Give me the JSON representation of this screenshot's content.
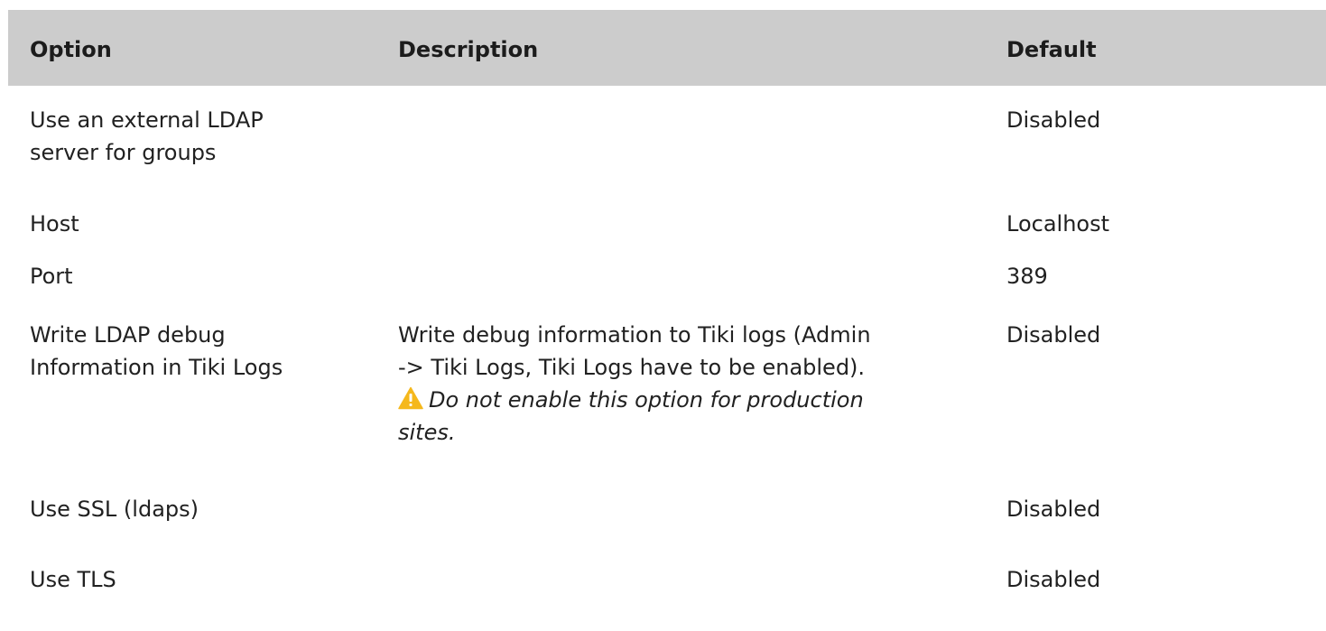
{
  "table": {
    "headers": {
      "option": "Option",
      "description": "Description",
      "default": "Default"
    },
    "rows": [
      {
        "option_lines": [
          "Use an external LDAP",
          "server for groups"
        ],
        "description_lines": [],
        "default": "Disabled"
      },
      {
        "option_lines": [
          "Host"
        ],
        "description_lines": [],
        "default": "Localhost"
      },
      {
        "option_lines": [
          "Port"
        ],
        "description_lines": [],
        "default": "389"
      },
      {
        "option_lines": [
          "Write LDAP debug",
          "Information in Tiki Logs"
        ],
        "description_lines": [
          "Write debug information to Tiki logs (Admin",
          "-> Tiki Logs, Tiki Logs have to be enabled)."
        ],
        "warning_icon": "warning-triangle-icon",
        "warning_lines": [
          "Do not enable this option for production",
          "sites."
        ],
        "default": "Disabled"
      },
      {
        "option_lines": [
          "Use SSL (ldaps)"
        ],
        "description_lines": [],
        "default": "Disabled"
      },
      {
        "option_lines": [
          "Use TLS"
        ],
        "description_lines": [],
        "default": "Disabled"
      }
    ]
  },
  "colors": {
    "header_bg": "#cccccc",
    "text": "#212121",
    "warning": "#f5b81c"
  }
}
